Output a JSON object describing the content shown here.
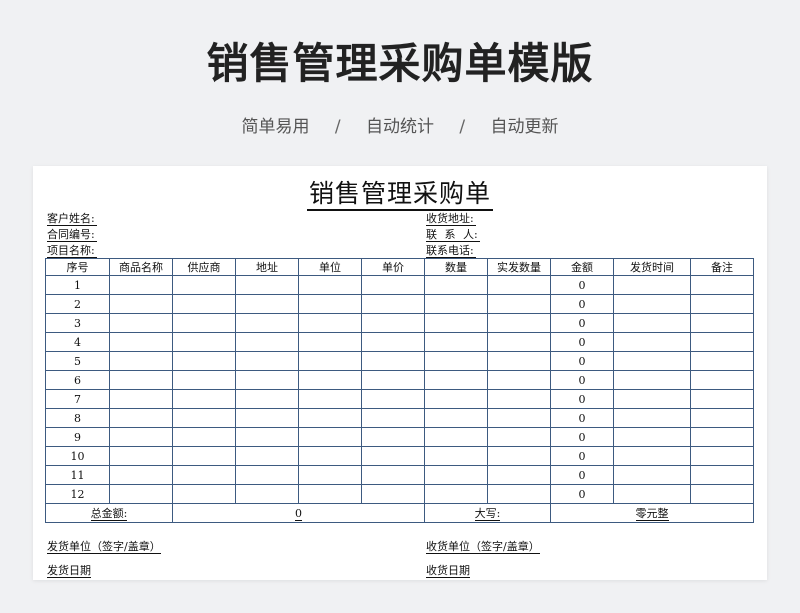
{
  "header": {
    "title": "销售管理采购单模版",
    "features": [
      "简单易用",
      "自动统计",
      "自动更新"
    ],
    "separator": "/"
  },
  "form": {
    "title": "销售管理采购单",
    "info_left": [
      "客户姓名:",
      "合同编号:",
      "项目名称:"
    ],
    "info_right": [
      "收货地址:",
      "联 系 人:",
      "联系电话:"
    ],
    "columns": [
      "序号",
      "商品名称",
      "供应商",
      "地址",
      "单位",
      "单价",
      "数量",
      "实发数量",
      "金额",
      "发货时间",
      "备注"
    ],
    "rows": [
      {
        "no": "1",
        "amount": "0"
      },
      {
        "no": "2",
        "amount": "0"
      },
      {
        "no": "3",
        "amount": "0"
      },
      {
        "no": "4",
        "amount": "0"
      },
      {
        "no": "5",
        "amount": "0"
      },
      {
        "no": "6",
        "amount": "0"
      },
      {
        "no": "7",
        "amount": "0"
      },
      {
        "no": "8",
        "amount": "0"
      },
      {
        "no": "9",
        "amount": "0"
      },
      {
        "no": "10",
        "amount": "0"
      },
      {
        "no": "11",
        "amount": "0"
      },
      {
        "no": "12",
        "amount": "0"
      }
    ],
    "total": {
      "label": "总金额:",
      "value": "0",
      "daxie_label": "大写:",
      "daxie_value": "零元整"
    },
    "footer": {
      "sender": "发货单位（签字/盖章）",
      "receiver": "收货单位（签字/盖章）",
      "send_date": "发货日期",
      "receive_date": "收货日期"
    }
  }
}
